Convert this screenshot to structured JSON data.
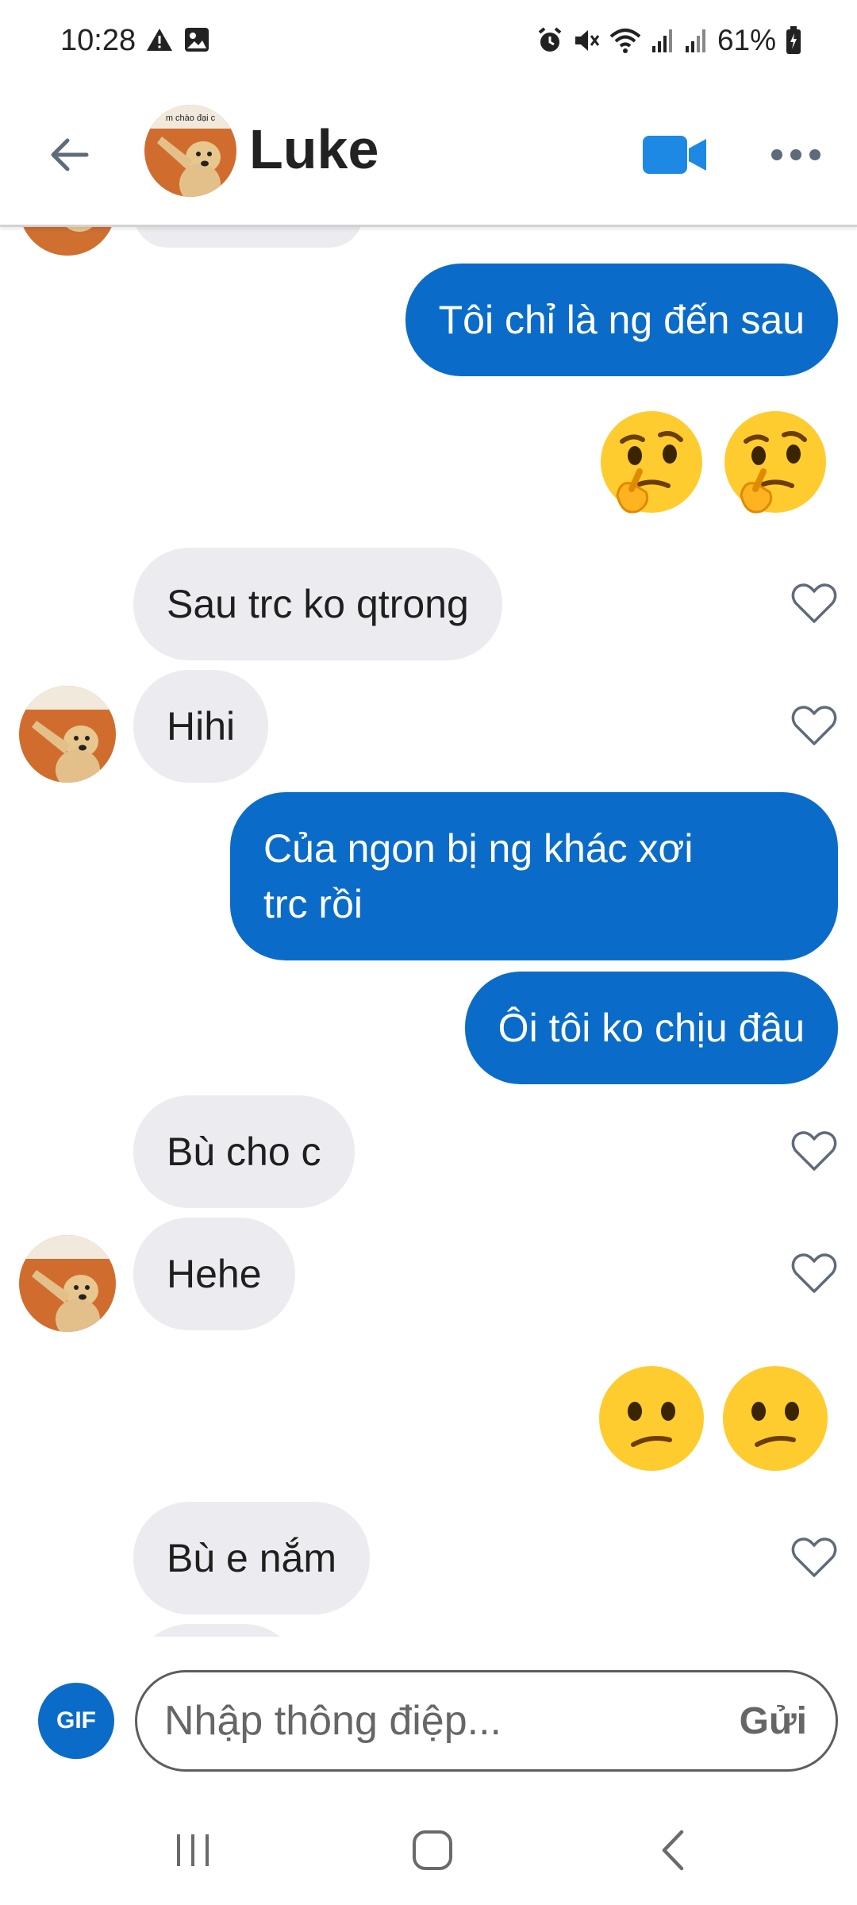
{
  "status_bar": {
    "time": "10:28",
    "battery": "61%",
    "left_icons": [
      "warning-icon",
      "image-icon"
    ],
    "right_icons": [
      "alarm-icon",
      "mute-icon",
      "wifi-icon",
      "signal-icon",
      "signal-icon",
      "battery-icon"
    ]
  },
  "header": {
    "contact_name": "Luke",
    "avatar_caption": "m chào đại c",
    "icons": [
      "back-arrow-icon",
      "video-call-icon",
      "more-dots-icon"
    ],
    "accent": "#1e88e5"
  },
  "messages": [
    {
      "side": "in",
      "text": "",
      "partial": true
    },
    {
      "side": "out",
      "text": "Tôi chỉ là ng đến sau"
    },
    {
      "side": "out",
      "emoji": "🤔🤔",
      "emoji_name": "thinking-face"
    },
    {
      "side": "in",
      "text": "Sau trc ko qtrong"
    },
    {
      "side": "in",
      "text": "Hihi"
    },
    {
      "side": "out",
      "lines": [
        "Của ngon bị ng khác xơi",
        "trc rồi"
      ]
    },
    {
      "side": "out",
      "text": "Ôi tôi ko chịu đâu"
    },
    {
      "side": "in",
      "text": "Bù cho c"
    },
    {
      "side": "in",
      "text": "Hehe"
    },
    {
      "side": "out",
      "emoji": "😕😕",
      "emoji_name": "confused-face"
    },
    {
      "side": "in",
      "text": "Bù e nắm"
    }
  ],
  "composer": {
    "gif_label": "GIF",
    "placeholder": "Nhập thông điệp...",
    "send_label": "Gửi"
  },
  "nav_bar": {
    "icons": [
      "recent-apps-icon",
      "home-icon",
      "back-icon"
    ]
  },
  "colors": {
    "outgoing_bubble": "#0a6cc8",
    "incoming_bubble": "#ececf0",
    "accent": "#0a6cc8"
  }
}
